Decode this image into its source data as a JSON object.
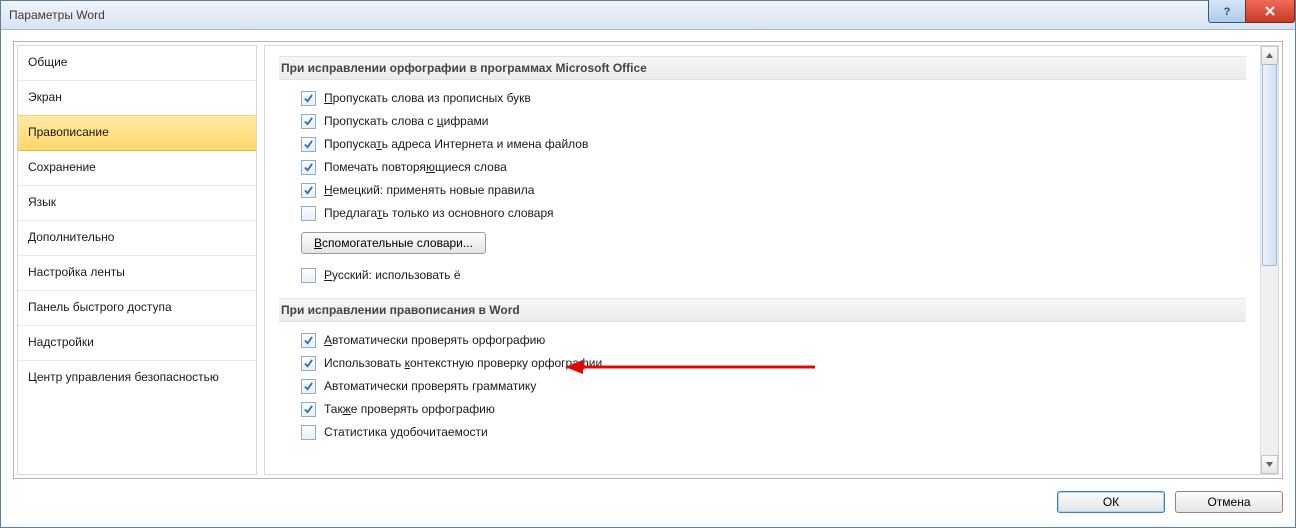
{
  "window": {
    "title": "Параметры Word"
  },
  "sidebar": {
    "items": [
      {
        "label": "Общие"
      },
      {
        "label": "Экран"
      },
      {
        "label": "Правописание",
        "selected": true
      },
      {
        "label": "Сохранение"
      },
      {
        "label": "Язык"
      },
      {
        "label": "Дополнительно"
      },
      {
        "label": "Настройка ленты"
      },
      {
        "label": "Панель быстрого доступа"
      },
      {
        "label": "Надстройки"
      },
      {
        "label": "Центр управления безопасностью"
      }
    ]
  },
  "sections": {
    "office": {
      "header": "При исправлении орфографии в программах Microsoft Office",
      "c0": {
        "checked": true,
        "label": "Пропускать слова из прописных букв",
        "u": "П"
      },
      "c1": {
        "checked": true,
        "label": "ропускать слова с ",
        "pre": "П",
        "mid": "ц",
        "post": "ифрами"
      },
      "c2": {
        "checked": true,
        "label": "Пропуска",
        "u": "т",
        "post": "ь адреса Интернета и имена файлов"
      },
      "c3": {
        "checked": true,
        "label": "Помечать повторя",
        "u": "ю",
        "post": "щиеся слова"
      },
      "c4": {
        "checked": true,
        "label": "Немецкий: применять новые правила",
        "u": "Н"
      },
      "c5": {
        "checked": false,
        "label": "Предлага",
        "u": "т",
        "post": "ь только из основного словаря"
      },
      "aux_btn": "спомогательные словари...",
      "aux_u": "В",
      "c6": {
        "checked": false,
        "label": "усский: использовать ё",
        "u": "Р"
      }
    },
    "word": {
      "header": "При исправлении правописания в Word",
      "c0": {
        "checked": true,
        "label": "втоматически проверять орфографию",
        "u": "А"
      },
      "c1": {
        "checked": true,
        "label": "Использовать ",
        "u": "к",
        "post": "онтекстную проверку орфографии"
      },
      "c2": {
        "checked": true,
        "label": "Автоматически проверять грамматику"
      },
      "c3": {
        "checked": true,
        "label": "Так",
        "u": "ж",
        "post": "е проверять орфографию"
      },
      "c4": {
        "checked": false,
        "label": "Статистика удобочитаемости"
      }
    }
  },
  "buttons": {
    "ok": "ОК",
    "cancel": "Отмена"
  }
}
